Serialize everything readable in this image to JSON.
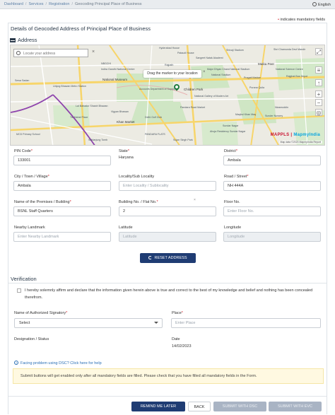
{
  "breadcrumb": {
    "items": [
      "Dashboard",
      "Services",
      "Registration",
      "Geocoding Principal Place of Business"
    ]
  },
  "language": "English",
  "mandatory_note": "indicates mandatory fields",
  "page": {
    "title": "Details of Geocoded Address of Principal Place of Business",
    "address_heading": "Address"
  },
  "map": {
    "search_placeholder": "Locate your address",
    "tooltip": "Drag the marker to your location",
    "brand_part1": "MAPPLS",
    "brand_part2": "MapmyIndia",
    "copyright": "Map data ©2023 MapmyIndia Report",
    "labels": {
      "hyderabad_house": "Hyderabad House",
      "pataudi_house": "Pataudi House",
      "sangeet_natak": "Sangeet Natak Akademi",
      "shivaji_stadium": "Shivaji Stadium",
      "chamunda_devi": "Shri Chamunda Devi Mandir",
      "rajpath": "Rajpath",
      "nbgchi": "NBGCHI",
      "indira_gandhi": "Indira Gandhi National Centre",
      "major_dhyan": "Major Dhyan Chand National Stadium",
      "national_stadium": "National Stadium",
      "matka_peer": "Matka Peer",
      "pragati_maidan": "Pragati Maidan",
      "national_science": "National Science Centre",
      "purana_quila": "Purana Quila",
      "bus_depot": "Rajghat Bus Depot",
      "sewa_sadan": "Sewa Sadan",
      "udyog_bhawan": "Udyog Bhawan Metro Station",
      "museum": "National Museum",
      "lal_bahadur": "Lal Bahadur Shastri Bhawan",
      "vigyan_bhawan": "Vigyan Bhawan",
      "accounts": "Accounts Department of Supply",
      "childrens_park": "Children Park",
      "modern_art": "National Gallery of Modern Art",
      "pandara_road": "Pandara Road Market",
      "golf_club": "Delhi Golf Club",
      "khan_market": "Khan Market",
      "nizamuddin": "Nizamuddin",
      "tis_mahal": "Tis Mahal Place",
      "mcd_primary": "MCD Primary School",
      "pandara_flats": "PANDARA FLATS",
      "sundar_nagar": "Sundar Nagar",
      "ahuja_residency": "Ahuja Residency Sundar Nagar",
      "maqbul_khan": "Maqbul Khan Maq",
      "sunder_nursery": "Sunder Nursery",
      "sujan_singh": "Sujan Singh Park",
      "safdarjung": "Safdarjung Tomb"
    }
  },
  "fields": {
    "pin_code": {
      "label": "PIN Code",
      "value": "133001"
    },
    "state": {
      "label": "State",
      "value": "Haryana"
    },
    "district": {
      "label": "District",
      "value": "Ambala"
    },
    "city": {
      "label": "City / Town / Village",
      "value": "Ambala"
    },
    "locality": {
      "label": "Locality/Sub Locality",
      "placeholder": "Enter Locality / Sublocality"
    },
    "road": {
      "label": "Road / Street",
      "value": "NH 444A"
    },
    "premises": {
      "label": "Name of the Premises / Building",
      "value": "BSNL Staff Quarters"
    },
    "building_no": {
      "label": "Building No. / Flat No.",
      "value": "2"
    },
    "floor_no": {
      "label": "Floor No.",
      "placeholder": "Enter Floor No."
    },
    "landmark": {
      "label": "Nearby Landmark",
      "placeholder": "Enter Nearby Landmark"
    },
    "latitude": {
      "label": "Latitude",
      "placeholder": "Latitude"
    },
    "longitude": {
      "label": "Longitude",
      "placeholder": "Longitude"
    }
  },
  "reset_button": "RESET ADDRESS",
  "verification": {
    "heading": "Verification",
    "declaration": "I hereby solemnly affirm and declare that the information given herein above is true and correct to the best of my knowledge and belief and nothing has been concealed therefrom.",
    "signatory_label": "Name of Authorized Signatory",
    "signatory_value": "Select",
    "place_label": "Place",
    "place_placeholder": "Enter Place",
    "designation_label": "Designation / Status",
    "date_label": "Date",
    "date_value": "14/02/2023"
  },
  "help_link": "Facing problem using DSC? Click here for help",
  "alert_text": "Submit buttons will get enabled only after all mandatory fields are filled. Please check that you have filled all mandatory fields in the Form.",
  "buttons": {
    "remind": "REMIND ME LATER",
    "back": "BACK",
    "dsc": "SUBMIT WITH DSC",
    "evc": "SUBMIT WITH EVC"
  },
  "colors": {
    "primary_button": "#1f3c73",
    "disabled_button": "#a9b4c4",
    "required_mark": "#d9232d",
    "alert_bg": "#fff9e1",
    "link": "#2a6fb5"
  }
}
